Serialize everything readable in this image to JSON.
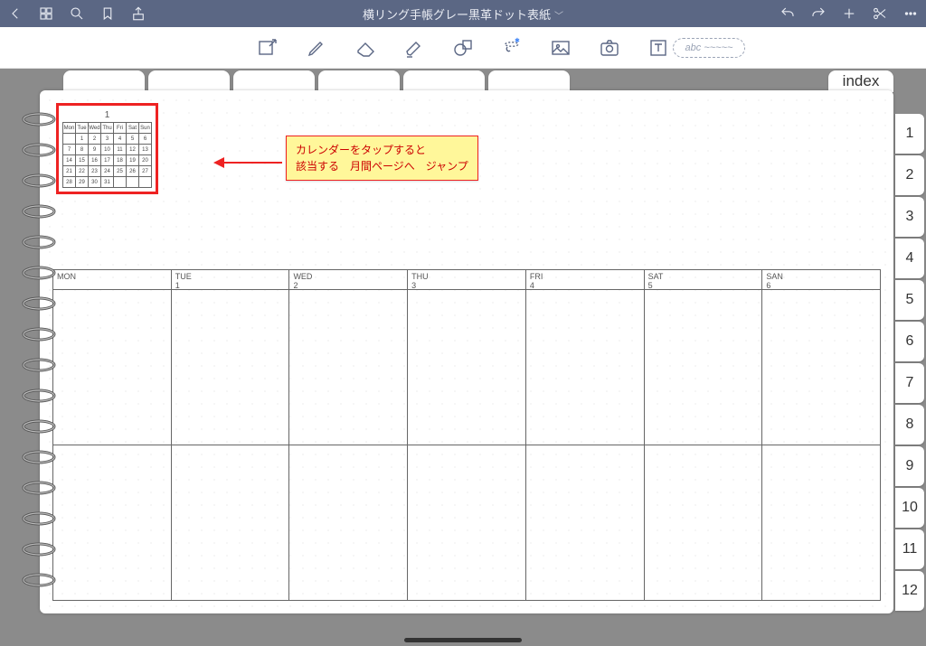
{
  "titlebar": {
    "title": "横リング手帳グレー黒革ドット表紙"
  },
  "abc_label": "abc ~~~~~",
  "index_label": "index",
  "side_tabs": [
    "1",
    "2",
    "3",
    "4",
    "5",
    "6",
    "7",
    "8",
    "9",
    "10",
    "11",
    "12"
  ],
  "mini_cal": {
    "month": "1",
    "dow": [
      "Mon",
      "Tue",
      "Wed",
      "Thu",
      "Fri",
      "Sat",
      "Sun"
    ],
    "rows": [
      [
        "",
        "1",
        "2",
        "3",
        "4",
        "5",
        "6"
      ],
      [
        "7",
        "8",
        "9",
        "10",
        "11",
        "12",
        "13"
      ],
      [
        "14",
        "15",
        "16",
        "17",
        "18",
        "19",
        "20"
      ],
      [
        "21",
        "22",
        "23",
        "24",
        "25",
        "26",
        "27"
      ],
      [
        "28",
        "29",
        "30",
        "31",
        "",
        "",
        ""
      ]
    ]
  },
  "callout": {
    "line1": "カレンダーをタップすると",
    "line2": "該当する　月間ページへ　ジャンプ"
  },
  "week": {
    "days": [
      {
        "name": "MON",
        "num": ""
      },
      {
        "name": "TUE",
        "num": "1"
      },
      {
        "name": "WED",
        "num": "2"
      },
      {
        "name": "THU",
        "num": "3"
      },
      {
        "name": "FRI",
        "num": "4"
      },
      {
        "name": "SAT",
        "num": "5"
      },
      {
        "name": "SAN",
        "num": "6"
      }
    ]
  }
}
